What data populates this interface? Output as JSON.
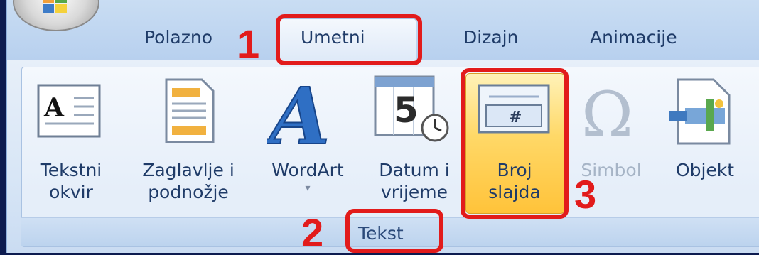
{
  "tabs": [
    {
      "label": "Polazno"
    },
    {
      "label": "Umetni"
    },
    {
      "label": "Dizajn"
    },
    {
      "label": "Animacije"
    }
  ],
  "ribbon": {
    "group_label": "Tekst",
    "commands": [
      {
        "line1": "Tekstni",
        "line2": "okvir",
        "icon": "text-box-icon"
      },
      {
        "line1": "Zaglavlje i",
        "line2": "podnožje",
        "icon": "header-footer-icon"
      },
      {
        "line1": "WordArt",
        "line2": "",
        "icon": "wordart-icon",
        "dropdown": "▾"
      },
      {
        "line1": "Datum i",
        "line2": "vrijeme",
        "icon": "date-time-icon"
      },
      {
        "line1": "Broj",
        "line2": "slajda",
        "icon": "slide-number-icon"
      },
      {
        "line1": "Simbol",
        "line2": "",
        "icon": "omega-icon"
      },
      {
        "line1": "Objekt",
        "line2": "",
        "icon": "object-icon"
      }
    ]
  },
  "annotations": {
    "step1": "1",
    "step2": "2",
    "step3": "3"
  },
  "icon_glyphs": {
    "wordart": "A",
    "date_day": "5",
    "slide_number": "#",
    "symbol": "Ω"
  },
  "colors": {
    "callout": "#e21b1b",
    "highlight": "#ffc33a"
  }
}
